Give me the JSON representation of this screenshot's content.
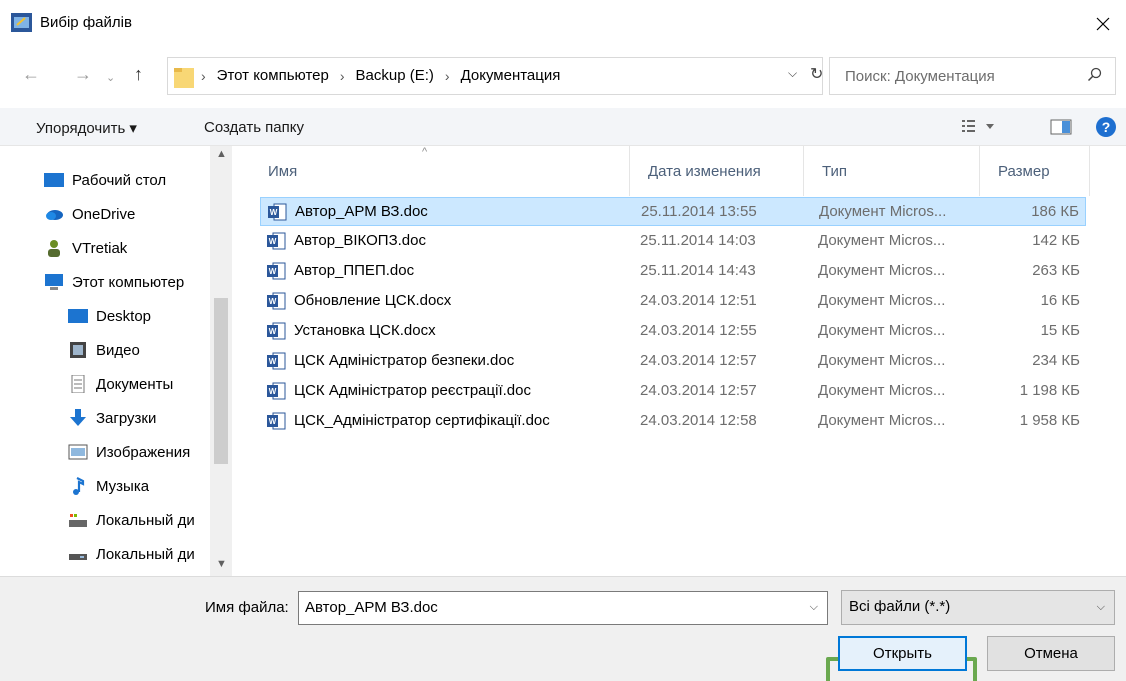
{
  "window": {
    "title": "Вибір файлів"
  },
  "nav": {
    "breadcrumbs": [
      "Этот компьютер",
      "Backup (E:)",
      "Документация"
    ],
    "search_placeholder": "Поиск: Документация"
  },
  "toolbar": {
    "organize": "Упорядочить ▾",
    "new_folder": "Создать папку"
  },
  "sidebar": {
    "items": [
      {
        "label": "Рабочий стол",
        "icon": "desktop-folder-icon"
      },
      {
        "label": "OneDrive",
        "icon": "onedrive-cloud-icon"
      },
      {
        "label": "VTretiak",
        "icon": "user-icon"
      },
      {
        "label": "Этот компьютер",
        "icon": "computer-icon"
      },
      {
        "label": "Desktop",
        "icon": "desktop-icon"
      },
      {
        "label": "Видео",
        "icon": "video-icon"
      },
      {
        "label": "Документы",
        "icon": "documents-icon"
      },
      {
        "label": "Загрузки",
        "icon": "downloads-icon"
      },
      {
        "label": "Изображения",
        "icon": "pictures-icon"
      },
      {
        "label": "Музыка",
        "icon": "music-icon"
      },
      {
        "label": "Локальный ди",
        "icon": "local-disk-icon"
      },
      {
        "label": "Локальный ди",
        "icon": "local-disk-icon"
      }
    ]
  },
  "list": {
    "columns": [
      "Имя",
      "Дата изменения",
      "Тип",
      "Размер"
    ],
    "files": [
      {
        "name": "Автор_АРМ ВЗ.doc",
        "date": "25.11.2014 13:55",
        "type": "Документ Micros...",
        "size": "186 КБ",
        "selected": true
      },
      {
        "name": "Автор_ВІКОПЗ.doc",
        "date": "25.11.2014 14:03",
        "type": "Документ Micros...",
        "size": "142 КБ"
      },
      {
        "name": "Автор_ППЕП.doc",
        "date": "25.11.2014 14:43",
        "type": "Документ Micros...",
        "size": "263 КБ"
      },
      {
        "name": "Обновление ЦСК.docx",
        "date": "24.03.2014 12:51",
        "type": "Документ Micros...",
        "size": "16 КБ"
      },
      {
        "name": "Установка ЦСК.docx",
        "date": "24.03.2014 12:55",
        "type": "Документ Micros...",
        "size": "15 КБ"
      },
      {
        "name": "ЦСК  Адміністратор безпеки.doc",
        "date": "24.03.2014 12:57",
        "type": "Документ Micros...",
        "size": "234 КБ"
      },
      {
        "name": "ЦСК  Адміністратор реєстрації.doc",
        "date": "24.03.2014 12:57",
        "type": "Документ Micros...",
        "size": "1 198 КБ"
      },
      {
        "name": "ЦСК_Адміністратор сертифікації.doc",
        "date": "24.03.2014 12:58",
        "type": "Документ Micros...",
        "size": "1 958 КБ"
      }
    ]
  },
  "bottom": {
    "filename_label": "Имя файла:",
    "filename_value": "Автор_АРМ ВЗ.doc",
    "filetype_value": "Всі файли (*.*)",
    "open_label": "Открыть",
    "cancel_label": "Отмена"
  },
  "colors": {
    "selection": "#cce8ff",
    "accent": "#0078d7",
    "highlight_frame": "#6aa84f"
  }
}
